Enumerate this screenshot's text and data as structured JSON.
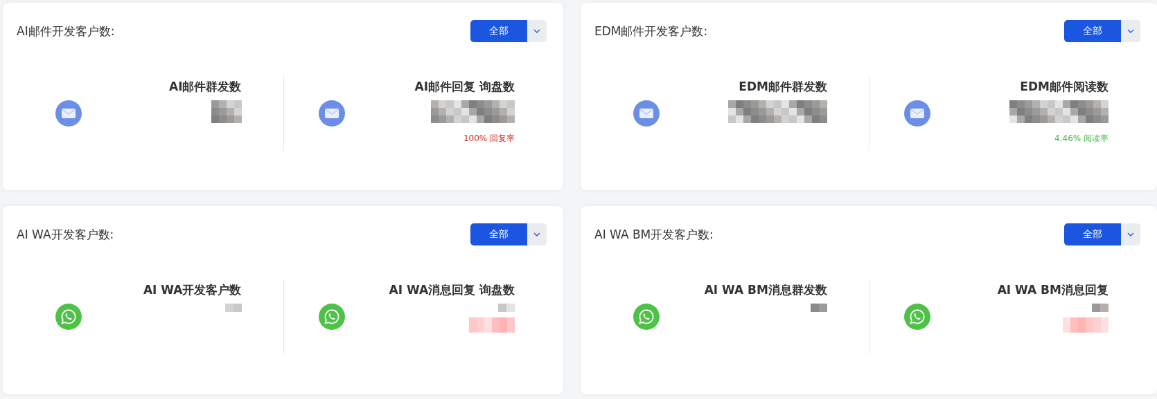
{
  "cards": [
    {
      "title": "AI邮件开发客户数:",
      "kind": "mail",
      "filter": {
        "label": "全部"
      },
      "stats": [
        {
          "label": "AI邮件群发数"
        },
        {
          "label": "AI邮件回复 询盘数",
          "rate": {
            "text": "100% 回复率",
            "color": "#d9221c"
          }
        }
      ]
    },
    {
      "title": "EDM邮件开发客户数:",
      "kind": "mail",
      "filter": {
        "label": "全部"
      },
      "stats": [
        {
          "label": "EDM邮件群发数"
        },
        {
          "label": "EDM邮件阅读数",
          "rate": {
            "text": "4.46% 阅读率",
            "color": "#3db84a"
          }
        }
      ]
    },
    {
      "title": "AI WA开发客户数:",
      "kind": "whatsapp",
      "filter": {
        "label": "全部"
      },
      "stats": [
        {
          "label": "AI WA开发客户数"
        },
        {
          "label": "AI WA消息回复 询盘数"
        }
      ]
    },
    {
      "title": "AI WA BM开发客户数:",
      "kind": "whatsapp",
      "filter": {
        "label": "全部"
      },
      "stats": [
        {
          "label": "AI WA BM消息群发数"
        },
        {
          "label": "AI WA BM消息回复"
        }
      ]
    }
  ]
}
